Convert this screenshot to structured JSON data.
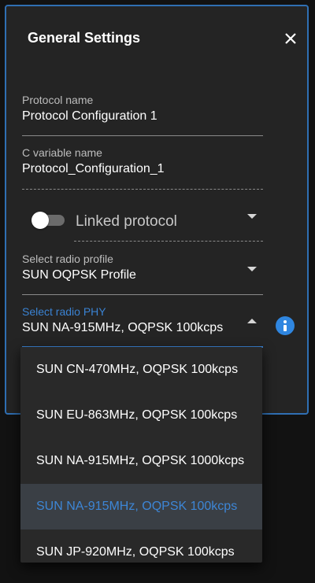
{
  "dialog": {
    "title": "General Settings",
    "close_icon": "close-icon"
  },
  "protocol_name": {
    "label": "Protocol name",
    "value": "Protocol Configuration 1"
  },
  "c_variable_name": {
    "label": "C variable name",
    "value": "Protocol_Configuration_1"
  },
  "linked_protocol": {
    "label": "Linked protocol",
    "enabled": false
  },
  "radio_profile": {
    "label": "Select radio profile",
    "value": "SUN OQPSK Profile"
  },
  "radio_phy": {
    "label": "Select radio PHY",
    "value": "SUN NA-915MHz, OQPSK 100kcps",
    "options": [
      "SUN CN-470MHz, OQPSK 100kcps",
      "SUN EU-863MHz, OQPSK 100kcps",
      "SUN NA-915MHz, OQPSK 1000kcps",
      "SUN NA-915MHz, OQPSK 100kcps",
      "SUN JP-920MHz, OQPSK 100kcps"
    ],
    "selected_index": 3
  },
  "colors": {
    "accent": "#3a82d2",
    "panel": "#242424",
    "info": "#2f86e0"
  }
}
